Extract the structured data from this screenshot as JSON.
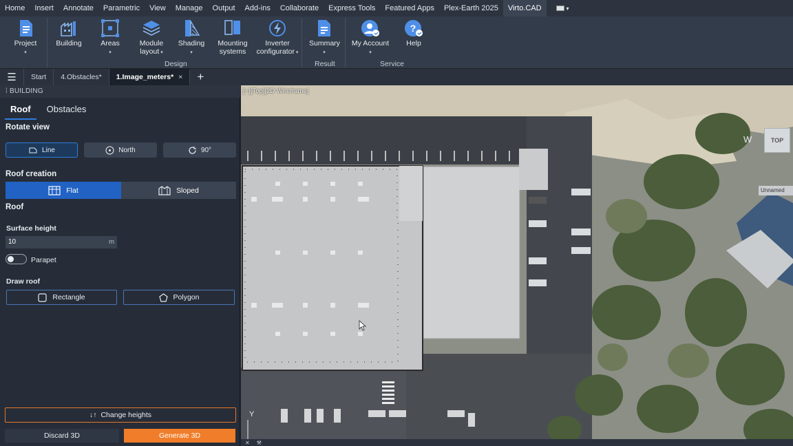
{
  "menu": [
    "Home",
    "Insert",
    "Annotate",
    "Parametric",
    "View",
    "Manage",
    "Output",
    "Add-ins",
    "Collaborate",
    "Express Tools",
    "Featured Apps",
    "Plex-Earth 2025",
    "Virto.CAD"
  ],
  "ribbon": {
    "project": "Project",
    "building": "Building",
    "areas": "Areas",
    "module_layout": [
      "Module",
      "layout"
    ],
    "shading": "Shading",
    "mounting_systems": [
      "Mounting",
      "systems"
    ],
    "inverter_configurator": [
      "Inverter",
      "configurator"
    ],
    "summary": "Summary",
    "my_account": "My Account",
    "help": "Help",
    "groups": {
      "design": "Design",
      "result": "Result",
      "service": "Service"
    }
  },
  "tabs": [
    "Start",
    "4.Obstacles*",
    "1.Image_meters*"
  ],
  "panel": {
    "title": "BUILDING",
    "tab_roof": "Roof",
    "tab_obstacles": "Obstacles",
    "rotate_view": "Rotate view",
    "btn_line": "Line",
    "btn_north": "North",
    "btn_90": "90°",
    "roof_creation": "Roof creation",
    "flat": "Flat",
    "sloped": "Sloped",
    "roof": "Roof",
    "surface_height": "Surface height",
    "surface_height_value": "10",
    "unit": "m",
    "parapet": "Parapet",
    "parapet_on": false,
    "draw_roof": "Draw roof",
    "rectangle": "Rectangle",
    "polygon": "Polygon",
    "change_heights": "Change heights",
    "discard_3d": "Discard 3D",
    "generate_3d": "Generate 3D"
  },
  "viewport": {
    "label": "[−][Top][2D Wireframe]",
    "viewcube": "TOP",
    "compass": "W",
    "unnamed": "Unnamed",
    "y_axis": "Y"
  },
  "colors": {
    "accent_blue": "#2162c4",
    "accent_orange": "#f07d2a"
  }
}
